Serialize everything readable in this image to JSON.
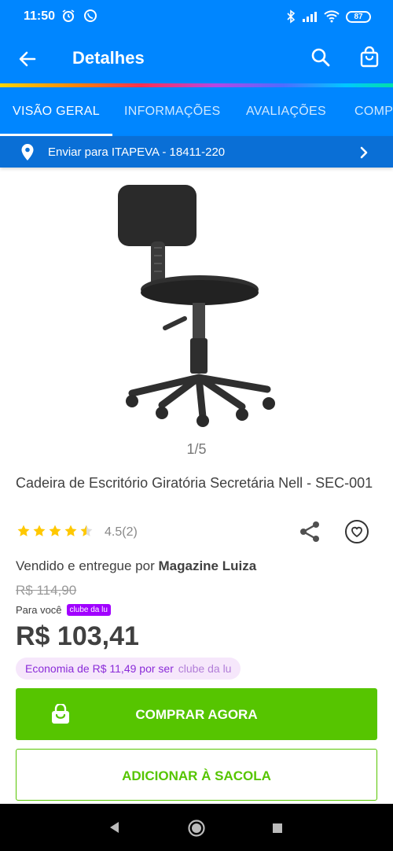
{
  "status_bar": {
    "time": "11:50",
    "battery": "87"
  },
  "app_bar": {
    "title": "Detalhes",
    "back_icon": "arrow-left-icon",
    "search_icon": "search-icon",
    "bag_icon": "shopping-bag-icon"
  },
  "tabs": [
    {
      "label": "VISÃO GERAL",
      "active": true
    },
    {
      "label": "INFORMAÇÕES",
      "active": false
    },
    {
      "label": "AVALIAÇÕES",
      "active": false
    },
    {
      "label": "COMP",
      "active": false
    }
  ],
  "shipping": {
    "text": "Enviar para ITAPEVA - 18411-220"
  },
  "gallery": {
    "pager": "1/5"
  },
  "product": {
    "title": "Cadeira de Escritório Giratória Secretária Nell - SEC-001",
    "rating_value": 4.5,
    "rating_text": "4.5(2)",
    "seller_prefix": "Vendido e entregue por ",
    "seller_name": "Magazine Luiza",
    "old_price": "R$ 114,90",
    "para_voce": "Para você",
    "clube_badge": "clube da lu",
    "price": "R$ 103,41",
    "economy_text": "Economia de R$ 11,49 por ser",
    "economy_clube": "clube da lu"
  },
  "buttons": {
    "buy": "COMPRAR AGORA",
    "add_to_bag": "ADICIONAR À SACOLA"
  },
  "colors": {
    "primary_blue": "#0086ff",
    "ship_blue": "#0a6fd6",
    "green": "#56c500",
    "star": "#ffc800",
    "purple": "#a100ff"
  }
}
